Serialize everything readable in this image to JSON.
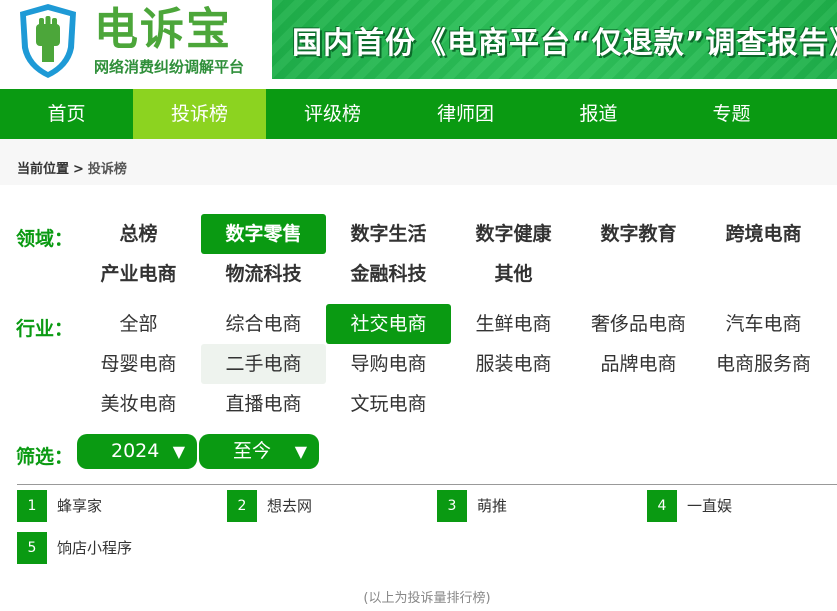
{
  "brand": {
    "name": "电诉宝",
    "subtitle": "网络消费纠纷调解平台",
    "banner_text": "国内首份《电商平台“仅退款”调查报告》",
    "colors": {
      "primary": "#0a9a12",
      "nav_active": "#8cd320",
      "logo_green": "#4ca63a"
    }
  },
  "nav": {
    "items": [
      {
        "label": "首页",
        "active": false
      },
      {
        "label": "投诉榜",
        "active": true
      },
      {
        "label": "评级榜",
        "active": false
      },
      {
        "label": "律师团",
        "active": false
      },
      {
        "label": "报道",
        "active": false
      },
      {
        "label": "专题",
        "active": false
      }
    ]
  },
  "breadcrumb": {
    "prefix": "当前位置",
    "separator": ">",
    "current": "投诉榜"
  },
  "domain_filter": {
    "label": "领域：",
    "options": [
      {
        "label": "总榜",
        "active": false
      },
      {
        "label": "数字零售",
        "active": true
      },
      {
        "label": "数字生活",
        "active": false
      },
      {
        "label": "数字健康",
        "active": false
      },
      {
        "label": "数字教育",
        "active": false
      },
      {
        "label": "跨境电商",
        "active": false
      },
      {
        "label": "产业电商",
        "active": false
      },
      {
        "label": "物流科技",
        "active": false
      },
      {
        "label": "金融科技",
        "active": false
      },
      {
        "label": "其他",
        "active": false
      }
    ]
  },
  "industry_filter": {
    "label": "行业：",
    "options": [
      {
        "label": "全部",
        "active": false
      },
      {
        "label": "综合电商",
        "active": false
      },
      {
        "label": "社交电商",
        "active": true
      },
      {
        "label": "生鲜电商",
        "active": false
      },
      {
        "label": "奢侈品电商",
        "active": false
      },
      {
        "label": "汽车电商",
        "active": false
      },
      {
        "label": "母婴电商",
        "active": false
      },
      {
        "label": "二手电商",
        "active": false,
        "hover": true
      },
      {
        "label": "导购电商",
        "active": false
      },
      {
        "label": "服装电商",
        "active": false
      },
      {
        "label": "品牌电商",
        "active": false
      },
      {
        "label": "电商服务商",
        "active": false
      },
      {
        "label": "美妆电商",
        "active": false
      },
      {
        "label": "直播电商",
        "active": false
      },
      {
        "label": "文玩电商",
        "active": false
      }
    ]
  },
  "period_filter": {
    "label": "筛选：",
    "year": "2024",
    "range": "至今",
    "arrow": "▼"
  },
  "ranking": [
    {
      "rank": "1",
      "name": "蜂享家"
    },
    {
      "rank": "2",
      "name": "想去网"
    },
    {
      "rank": "3",
      "name": "萌推"
    },
    {
      "rank": "4",
      "name": "一直娱"
    },
    {
      "rank": "5",
      "name": "饷店小程序"
    }
  ],
  "footer_note": "(以上为投诉量排行榜)"
}
